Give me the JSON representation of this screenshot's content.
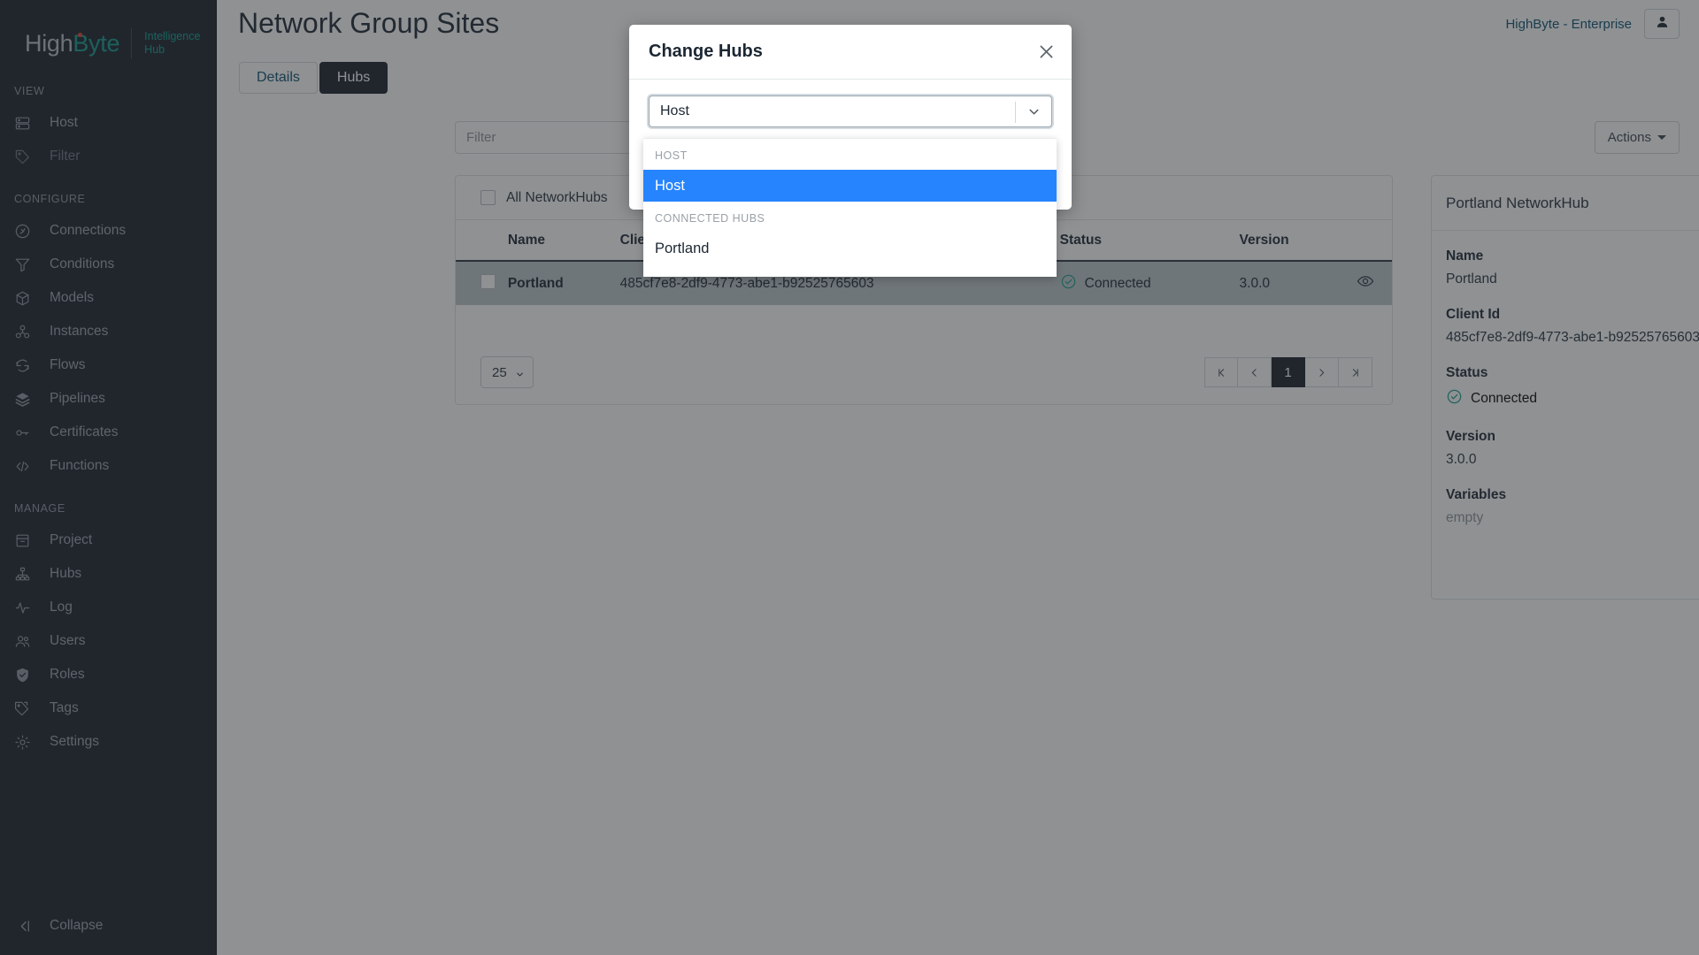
{
  "brand": {
    "name_first": "High",
    "name_second": "Byte",
    "sub_line1": "Intelligence",
    "sub_line2": "Hub",
    "accent": "#0f9b8e",
    "dot_color": "#e8402a"
  },
  "sidebar": {
    "sections": [
      {
        "title": "VIEW",
        "items": [
          {
            "label": "Host",
            "icon": "server-icon",
            "dim": false
          },
          {
            "label": "Filter",
            "icon": "tag-icon",
            "dim": true
          }
        ]
      },
      {
        "title": "CONFIGURE",
        "items": [
          {
            "label": "Connections",
            "icon": "plug-icon",
            "dim": false
          },
          {
            "label": "Conditions",
            "icon": "funnel-icon",
            "dim": false
          },
          {
            "label": "Models",
            "icon": "cube-icon",
            "dim": false
          },
          {
            "label": "Instances",
            "icon": "instances-icon",
            "dim": false
          },
          {
            "label": "Flows",
            "icon": "refresh-icon",
            "dim": false
          },
          {
            "label": "Pipelines",
            "icon": "layers-icon",
            "dim": false
          },
          {
            "label": "Certificates",
            "icon": "key-icon",
            "dim": false
          },
          {
            "label": "Functions",
            "icon": "code-icon",
            "dim": false
          }
        ]
      },
      {
        "title": "MANAGE",
        "items": [
          {
            "label": "Project",
            "icon": "archive-icon",
            "dim": false
          },
          {
            "label": "Hubs",
            "icon": "hubs-icon",
            "dim": false
          },
          {
            "label": "Log",
            "icon": "activity-icon",
            "dim": false
          },
          {
            "label": "Users",
            "icon": "users-icon",
            "dim": false
          },
          {
            "label": "Roles",
            "icon": "shield-check-icon",
            "dim": false
          },
          {
            "label": "Tags",
            "icon": "tags-icon",
            "dim": false
          },
          {
            "label": "Settings",
            "icon": "gear-icon",
            "dim": false
          }
        ]
      }
    ],
    "collapse_label": "Collapse"
  },
  "header": {
    "page_title": "Network Group Sites",
    "org_name": "HighByte - Enterprise",
    "avatar_icon": "user-icon"
  },
  "tabs": [
    {
      "label": "Details",
      "active": false
    },
    {
      "label": "Hubs",
      "active": true
    }
  ],
  "toolbar": {
    "filter_placeholder": "Filter",
    "filter_value": "",
    "actions_label": "Actions"
  },
  "table": {
    "select_all_label": "All NetworkHubs",
    "columns": [
      "Name",
      "Client Id",
      "Status",
      "Version"
    ],
    "rows": [
      {
        "name": "Portland",
        "client_id": "485cf7e8-2df9-4773-abe1-b92525765603",
        "status": "Connected",
        "version": "3.0.0",
        "selected": true
      }
    ],
    "page_size": "25",
    "current_page": "1",
    "pager": {
      "first": "⧏|",
      "prev": "‹",
      "next": "›",
      "last": "|⧐"
    }
  },
  "detail": {
    "title": "Portland NetworkHub",
    "fields": [
      {
        "label": "Name",
        "value": "Portland",
        "muted": false
      },
      {
        "label": "Client Id",
        "value": "485cf7e8-2df9-4773-abe1-b92525765603",
        "muted": false
      },
      {
        "label": "Status",
        "value": "Connected",
        "muted": false,
        "is_status": true
      },
      {
        "label": "Version",
        "value": "3.0.0",
        "muted": false
      },
      {
        "label": "Variables",
        "value": "empty",
        "muted": true
      }
    ]
  },
  "modal": {
    "title": "Change Hubs",
    "close_icon": "close-icon",
    "select": {
      "value": "Host",
      "arrow_icon": "chevron-down-icon"
    },
    "dropdown": {
      "groups": [
        {
          "label": "HOST",
          "options": [
            {
              "label": "Host",
              "selected": true
            }
          ]
        },
        {
          "label": "CONNECTED HUBS",
          "options": [
            {
              "label": "Portland",
              "selected": false
            }
          ]
        }
      ],
      "highlight_color": "#2684ff"
    }
  },
  "colors": {
    "sidebar_bg": "#1b212b",
    "link": "#0c5070",
    "status_ok": "#1f9e8e",
    "row_selected": "#bcc6cb"
  }
}
